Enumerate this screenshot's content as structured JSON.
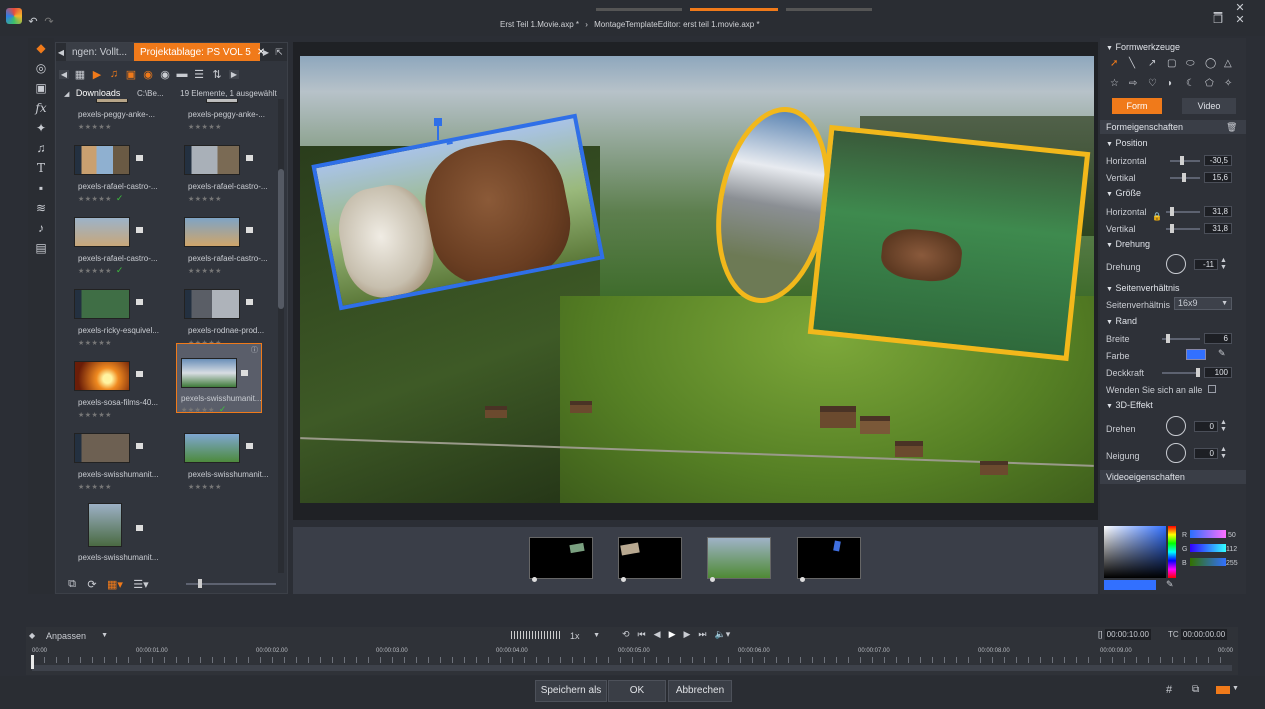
{
  "title": {
    "tab1": "Erst Teil 1.Movie.axp *",
    "sep": "›",
    "tab2": "MontageTemplateEditor: erst teil 1.movie.axp *"
  },
  "library": {
    "tabs": [
      "ngen: Vollt...",
      "Projektablage: PS VOL 5"
    ],
    "folder": "Downloads",
    "path": "C:\\Be...",
    "count": "19 Elemente, 1 ausgewählt",
    "items": [
      {
        "name": "pexels-peggy-anke-...",
        "stars": "★★★★★",
        "check": ""
      },
      {
        "name": "pexels-peggy-anke-...",
        "stars": "★★★★★",
        "check": ""
      },
      {
        "name": "pexels-rafael-castro-...",
        "stars": "★★★★★",
        "check": "✓"
      },
      {
        "name": "pexels-rafael-castro-...",
        "stars": "★★★★★",
        "check": ""
      },
      {
        "name": "pexels-rafael-castro-...",
        "stars": "★★★★★",
        "check": "✓"
      },
      {
        "name": "pexels-rafael-castro-...",
        "stars": "★★★★★",
        "check": ""
      },
      {
        "name": "pexels-ricky-esquivel...",
        "stars": "★★★★★",
        "check": ""
      },
      {
        "name": "pexels-rodnae-prod...",
        "stars": "★★★★★",
        "check": ""
      },
      {
        "name": "pexels-sosa-films-40...",
        "stars": "★★★★★",
        "check": ""
      },
      {
        "name": "pexels-swisshumanit...",
        "stars": "★★★★★",
        "check": "✓"
      },
      {
        "name": "pexels-swisshumanit...",
        "stars": "★★★★★",
        "check": ""
      },
      {
        "name": "pexels-swisshumanit...",
        "stars": "★★★★★",
        "check": ""
      },
      {
        "name": "pexels-swisshumanit...",
        "stars": "",
        "check": ""
      }
    ]
  },
  "panel": {
    "formwerkzeuge": "Formwerkzeuge",
    "tab_form": "Form",
    "tab_video": "Video",
    "formeigenschaften": "Formeigenschaften",
    "position": "Position",
    "horizontal": "Horizontal",
    "vertikal": "Vertikal",
    "pos_h": "-30,5",
    "pos_v": "15,6",
    "groesse": "Größe",
    "size_h": "31,8",
    "size_v": "31,8",
    "drehung_head": "Drehung",
    "drehung": "Drehung",
    "drehung_val": "-11",
    "seitenverhaeltnis_head": "Seitenverhältnis",
    "seitenverhaeltnis": "Seitenverhältnis",
    "ratio": "16x9",
    "rand": "Rand",
    "breite": "Breite",
    "breite_val": "6",
    "farbe": "Farbe",
    "deckkraft": "Deckkraft",
    "deckkraft_val": "100",
    "wenden": "Wenden Sie sich an alle",
    "effekt3d": "3D-Effekt",
    "drehen": "Drehen",
    "drehen_val": "0",
    "neigung": "Neigung",
    "neigung_val": "0",
    "videoeigenschaften": "Videoeigenschaften",
    "rgb": {
      "r_label": "R",
      "g_label": "G",
      "b_label": "B",
      "r": "50",
      "g": "112",
      "b": "255"
    }
  },
  "timeline": {
    "fit": "Anpassen",
    "speed": "1x",
    "duration": "00:00:10.00",
    "tc_label": "TC",
    "timecode": "00:00:00.00",
    "ticks": [
      "00:00",
      "00:00:01.00",
      "00:00:02.00",
      "00:00:03.00",
      "00:00:04.00",
      "00:00:05.00",
      "00:00:06.00",
      "00:00:07.00",
      "00:00:08.00",
      "00:00:09.00",
      "00:00"
    ]
  },
  "buttons": {
    "save_as": "Speichern als",
    "ok": "OK",
    "cancel": "Abbrechen"
  },
  "colors": {
    "accent": "#f07a1a",
    "border_blue": "#2f6fe8",
    "border_yellow": "#f2b81b",
    "swatch": "#3270ff"
  }
}
